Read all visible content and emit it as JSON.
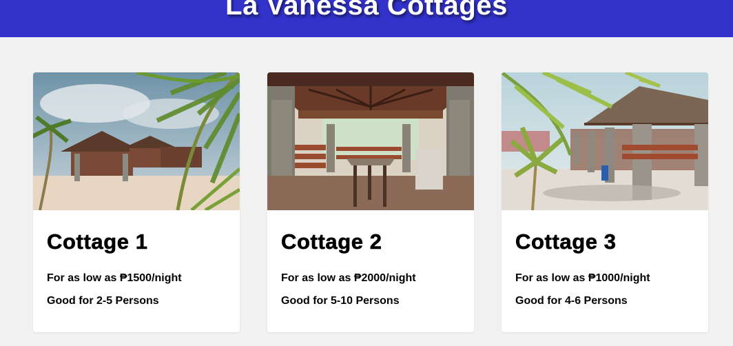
{
  "header": {
    "title": "La Vanessa Cottages"
  },
  "cards": [
    {
      "title": "Cottage 1",
      "price": "For as low as ₱1500/night",
      "capacity": "Good for 2-5 Persons"
    },
    {
      "title": "Cottage 2",
      "price": "For as low as ₱2000/night",
      "capacity": "Good for 5-10 Persons"
    },
    {
      "title": "Cottage 3",
      "price": "For as low as ₱1000/night",
      "capacity": "Good for 4-6 Persons"
    }
  ],
  "colors": {
    "header_bg": "#3333cc",
    "page_bg": "#f2f2f2",
    "card_bg": "#ffffff"
  }
}
